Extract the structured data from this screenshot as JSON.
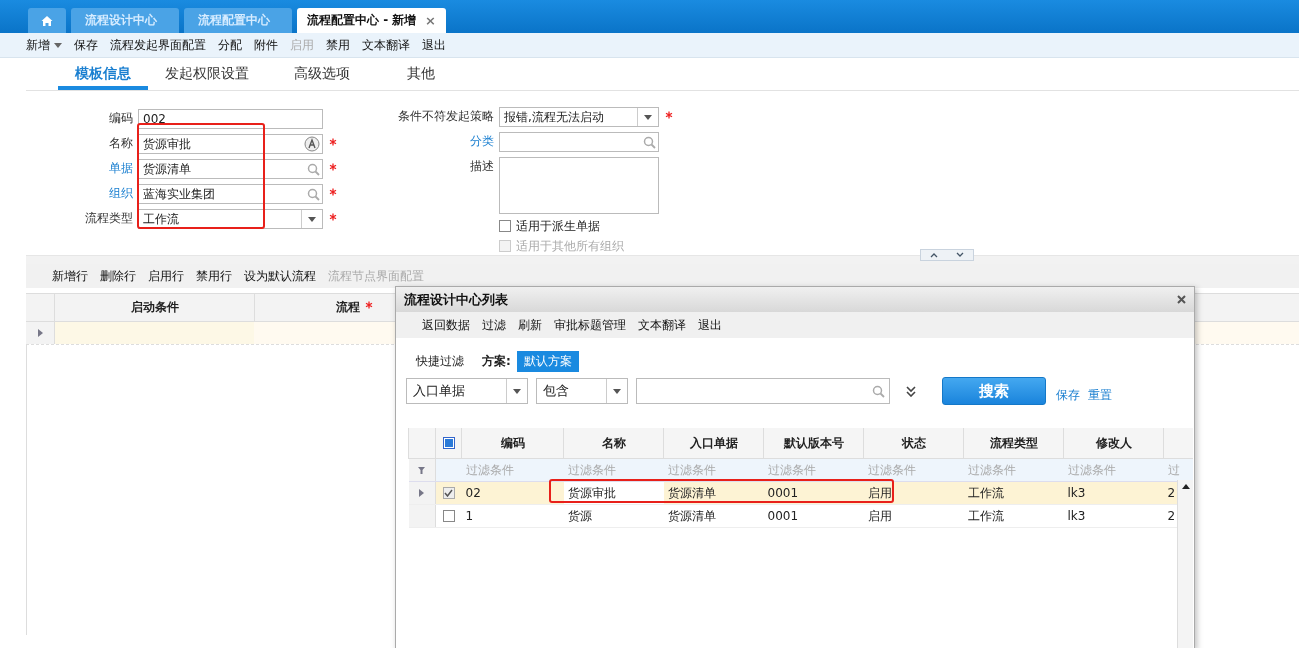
{
  "app_tabs": [
    {
      "kind": "home",
      "selected": false
    },
    {
      "kind": "text",
      "label": "流程设计中心",
      "selected": false
    },
    {
      "kind": "text",
      "label": "流程配置中心",
      "selected": false
    },
    {
      "kind": "text",
      "label": "流程配置中心 - 新增",
      "selected": true,
      "close": "×"
    }
  ],
  "toolbar": [
    {
      "label": "新增",
      "dropdown": true,
      "disabled": false
    },
    {
      "label": "保存",
      "disabled": false
    },
    {
      "label": "流程发起界面配置",
      "disabled": false
    },
    {
      "label": "分配",
      "disabled": false
    },
    {
      "label": "附件",
      "disabled": false
    },
    {
      "label": "启用",
      "disabled": true
    },
    {
      "label": "禁用",
      "disabled": false
    },
    {
      "label": "文本翻译",
      "disabled": false
    },
    {
      "label": "退出",
      "disabled": false
    }
  ],
  "section_tabs": [
    {
      "label": "模板信息",
      "selected": true
    },
    {
      "label": "发起权限设置",
      "selected": false
    },
    {
      "label": "高级选项",
      "selected": false
    },
    {
      "label": "其他",
      "selected": false
    }
  ],
  "form": {
    "highlighted": true,
    "left": [
      {
        "label": "编码",
        "value": "002",
        "link": false,
        "required": false,
        "kind": "text"
      },
      {
        "label": "名称",
        "value": "货源审批",
        "link": false,
        "required": true,
        "kind": "multilingual"
      },
      {
        "label": "单据",
        "value": "货源清单",
        "link": true,
        "required": true,
        "kind": "lookup"
      },
      {
        "label": "组织",
        "value": "蓝海实业集团",
        "link": true,
        "required": true,
        "kind": "lookup"
      },
      {
        "label": "流程类型",
        "value": "工作流",
        "link": false,
        "required": true,
        "kind": "select"
      }
    ],
    "right": [
      {
        "label": "条件不符发起策略",
        "value": "报错,流程无法启动",
        "link": false,
        "required": true,
        "kind": "select"
      },
      {
        "label": "分类",
        "link": true,
        "required": false,
        "kind": "lookup"
      },
      {
        "label": "描述",
        "link": false,
        "required": false,
        "kind": "textarea"
      }
    ],
    "checkboxes": [
      {
        "label": "适用于派生单据",
        "checked": false,
        "disabled": false
      },
      {
        "label": "适用于其他所有组织",
        "checked": false,
        "disabled": true
      }
    ]
  },
  "grid_toolbar": [
    {
      "label": "新增行",
      "disabled": false
    },
    {
      "label": "删除行",
      "disabled": false
    },
    {
      "label": "启用行",
      "disabled": false
    },
    {
      "label": "禁用行",
      "disabled": false
    },
    {
      "label": "设为默认流程",
      "disabled": false
    },
    {
      "label": "流程节点界面配置",
      "disabled": true
    }
  ],
  "grid": {
    "columns": [
      {
        "label": "启动条件",
        "required": false
      },
      {
        "label": "流程",
        "required": true
      }
    ],
    "rows": [
      {
        "selected": true
      }
    ]
  },
  "dialog": {
    "title": "流程设计中心列表",
    "toolbar": [
      "返回数据",
      "过滤",
      "刷新",
      "审批标题管理",
      "文本翻译",
      "退出"
    ],
    "quick_filter_label": "快捷过滤",
    "scheme_label": "方案:",
    "scheme": "默认方案",
    "filter_field": "入口单据",
    "filter_operator": "包含",
    "search_button": "搜索",
    "links": [
      "保存",
      "重置"
    ],
    "table": {
      "all_checked": true,
      "columns": [
        "编码",
        "名称",
        "入口单据",
        "默认版本号",
        "状态",
        "流程类型",
        "修改人"
      ],
      "filter_row": [
        "过滤条件",
        "过滤条件",
        "过滤条件",
        "过滤条件",
        "过滤条件",
        "过滤条件",
        "过滤条件",
        "过"
      ],
      "rows": [
        {
          "selected": true,
          "checked": true,
          "highlighted": true,
          "cells": [
            "02",
            "货源审批",
            "货源清单",
            "0001",
            "启用",
            "工作流",
            "lk3"
          ],
          "column_9": "2"
        },
        {
          "selected": false,
          "checked": false,
          "highlighted": false,
          "cells": [
            "1",
            "货源",
            "货源清单",
            "0001",
            "启用",
            "工作流",
            "lk3"
          ],
          "column_9": "2"
        }
      ]
    }
  }
}
